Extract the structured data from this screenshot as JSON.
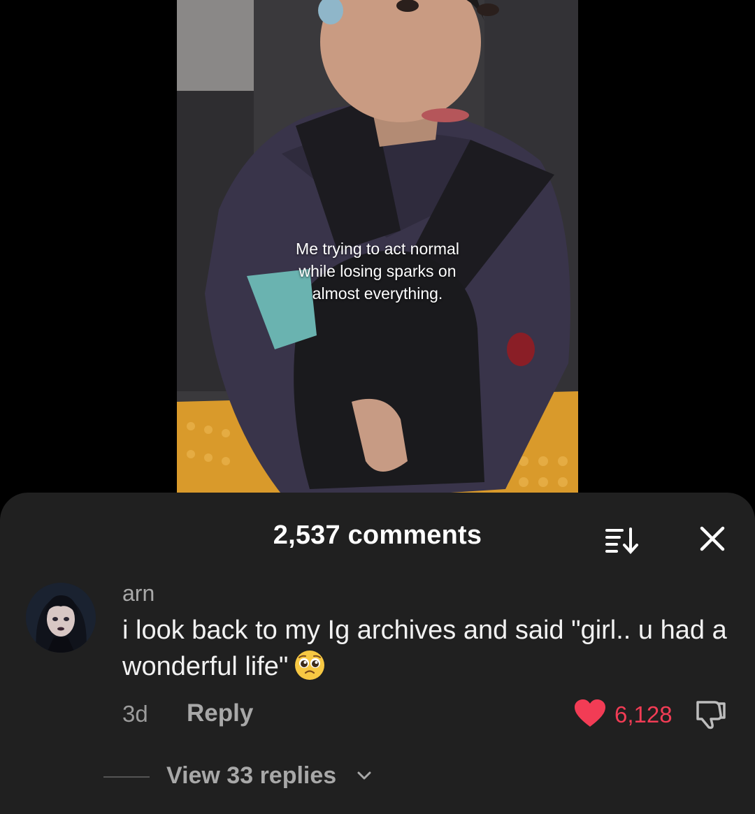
{
  "video": {
    "caption_lines": [
      "Me trying to act normal",
      "while losing sparks on",
      "almost everything."
    ]
  },
  "comments_sheet": {
    "count_label": "2,537 comments",
    "sort_icon": "sort-descending-icon",
    "close_icon": "close-icon"
  },
  "comment": {
    "username": "arn",
    "text": "i look back to my Ig archives and said \"girl.. u had a wonderful life\"",
    "emoji": "pleading-face-emoji",
    "timestamp": "3d",
    "reply_label": "Reply",
    "like_count": "6,128",
    "like_color": "#f23c55",
    "view_replies_label": "View 33 replies"
  }
}
